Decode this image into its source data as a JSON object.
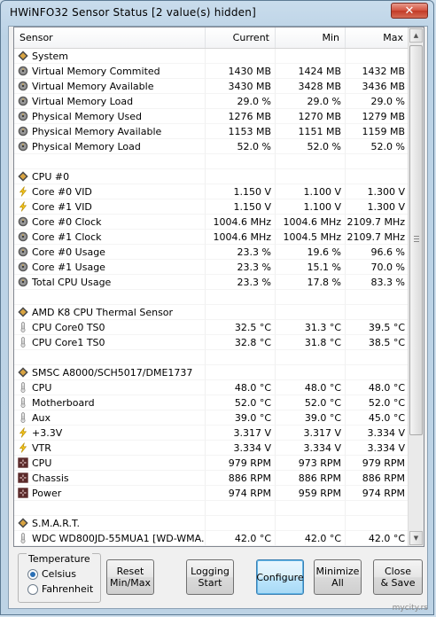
{
  "window": {
    "title": "HWiNFO32 Sensor Status [2 value(s) hidden]",
    "close_glyph": "✕"
  },
  "columns": {
    "sensor": "Sensor",
    "current": "Current",
    "min": "Min",
    "max": "Max"
  },
  "rows": [
    {
      "type": "group",
      "icon": "chip-icon",
      "name": "System"
    },
    {
      "type": "item",
      "icon": "disc-icon",
      "name": "Virtual Memory Commited",
      "cur": "1430 MB",
      "min": "1424 MB",
      "max": "1432 MB"
    },
    {
      "type": "item",
      "icon": "disc-icon",
      "name": "Virtual Memory Available",
      "cur": "3430 MB",
      "min": "3428 MB",
      "max": "3436 MB"
    },
    {
      "type": "item",
      "icon": "disc-icon",
      "name": "Virtual Memory Load",
      "cur": "29.0 %",
      "min": "29.0 %",
      "max": "29.0 %"
    },
    {
      "type": "item",
      "icon": "disc-icon",
      "name": "Physical Memory Used",
      "cur": "1276 MB",
      "min": "1270 MB",
      "max": "1279 MB"
    },
    {
      "type": "item",
      "icon": "disc-icon",
      "name": "Physical Memory Available",
      "cur": "1153 MB",
      "min": "1151 MB",
      "max": "1159 MB"
    },
    {
      "type": "item",
      "icon": "disc-icon",
      "name": "Physical Memory Load",
      "cur": "52.0 %",
      "min": "52.0 %",
      "max": "52.0 %"
    },
    {
      "type": "blank"
    },
    {
      "type": "group",
      "icon": "chip-icon",
      "name": "CPU #0"
    },
    {
      "type": "item",
      "icon": "lightning-icon",
      "name": "Core #0 VID",
      "cur": "1.150 V",
      "min": "1.100 V",
      "max": "1.300 V"
    },
    {
      "type": "item",
      "icon": "lightning-icon",
      "name": "Core #1 VID",
      "cur": "1.150 V",
      "min": "1.100 V",
      "max": "1.300 V"
    },
    {
      "type": "item",
      "icon": "disc-icon",
      "name": "Core #0 Clock",
      "cur": "1004.6 MHz",
      "min": "1004.6 MHz",
      "max": "2109.7 MHz"
    },
    {
      "type": "item",
      "icon": "disc-icon",
      "name": "Core #1 Clock",
      "cur": "1004.6 MHz",
      "min": "1004.5 MHz",
      "max": "2109.7 MHz"
    },
    {
      "type": "item",
      "icon": "disc-icon",
      "name": "Core #0 Usage",
      "cur": "23.3 %",
      "min": "19.6 %",
      "max": "96.6 %"
    },
    {
      "type": "item",
      "icon": "disc-icon",
      "name": "Core #1 Usage",
      "cur": "23.3 %",
      "min": "15.1 %",
      "max": "70.0 %"
    },
    {
      "type": "item",
      "icon": "disc-icon",
      "name": "Total CPU Usage",
      "cur": "23.3 %",
      "min": "17.8 %",
      "max": "83.3 %"
    },
    {
      "type": "blank"
    },
    {
      "type": "group",
      "icon": "chip-icon",
      "name": "AMD K8 CPU Thermal Sensor"
    },
    {
      "type": "item",
      "icon": "thermometer-icon",
      "name": "CPU Core0 TS0",
      "cur": "32.5 °C",
      "min": "31.3 °C",
      "max": "39.5 °C"
    },
    {
      "type": "item",
      "icon": "thermometer-icon",
      "name": "CPU Core1 TS0",
      "cur": "32.8 °C",
      "min": "31.8 °C",
      "max": "38.5 °C"
    },
    {
      "type": "blank"
    },
    {
      "type": "group",
      "icon": "chip-icon",
      "name": "SMSC A8000/SCH5017/DME1737"
    },
    {
      "type": "item",
      "icon": "thermometer-icon",
      "name": "CPU",
      "cur": "48.0 °C",
      "min": "48.0 °C",
      "max": "48.0 °C"
    },
    {
      "type": "item",
      "icon": "thermometer-icon",
      "name": "Motherboard",
      "cur": "52.0 °C",
      "min": "52.0 °C",
      "max": "52.0 °C"
    },
    {
      "type": "item",
      "icon": "thermometer-icon",
      "name": "Aux",
      "cur": "39.0 °C",
      "min": "39.0 °C",
      "max": "45.0 °C"
    },
    {
      "type": "item",
      "icon": "lightning-icon",
      "name": "+3.3V",
      "cur": "3.317 V",
      "min": "3.317 V",
      "max": "3.334 V"
    },
    {
      "type": "item",
      "icon": "lightning-icon",
      "name": "VTR",
      "cur": "3.334 V",
      "min": "3.334 V",
      "max": "3.334 V"
    },
    {
      "type": "item",
      "icon": "fan-icon",
      "name": "CPU",
      "cur": "979 RPM",
      "min": "973 RPM",
      "max": "979 RPM"
    },
    {
      "type": "item",
      "icon": "fan-icon",
      "name": "Chassis",
      "cur": "886 RPM",
      "min": "886 RPM",
      "max": "886 RPM"
    },
    {
      "type": "item",
      "icon": "fan-icon",
      "name": "Power",
      "cur": "974 RPM",
      "min": "959 RPM",
      "max": "974 RPM"
    },
    {
      "type": "blank"
    },
    {
      "type": "group",
      "icon": "chip-icon",
      "name": "S.M.A.R.T."
    },
    {
      "type": "item",
      "icon": "thermometer-icon",
      "name": "WDC WD800JD-55MUA1 [WD-WMA...",
      "cur": "42.0 °C",
      "min": "42.0 °C",
      "max": "42.0 °C"
    }
  ],
  "temperature": {
    "label": "Temperature",
    "celsius": "Celsius",
    "fahrenheit": "Fahrenheit",
    "selected": "Celsius"
  },
  "buttons": {
    "reset": "Reset\nMin/Max",
    "logging": "Logging\nStart",
    "configure": "Configure",
    "minimize": "Minimize\nAll",
    "close": "Close\n& Save"
  },
  "watermark": "mycity.rs"
}
